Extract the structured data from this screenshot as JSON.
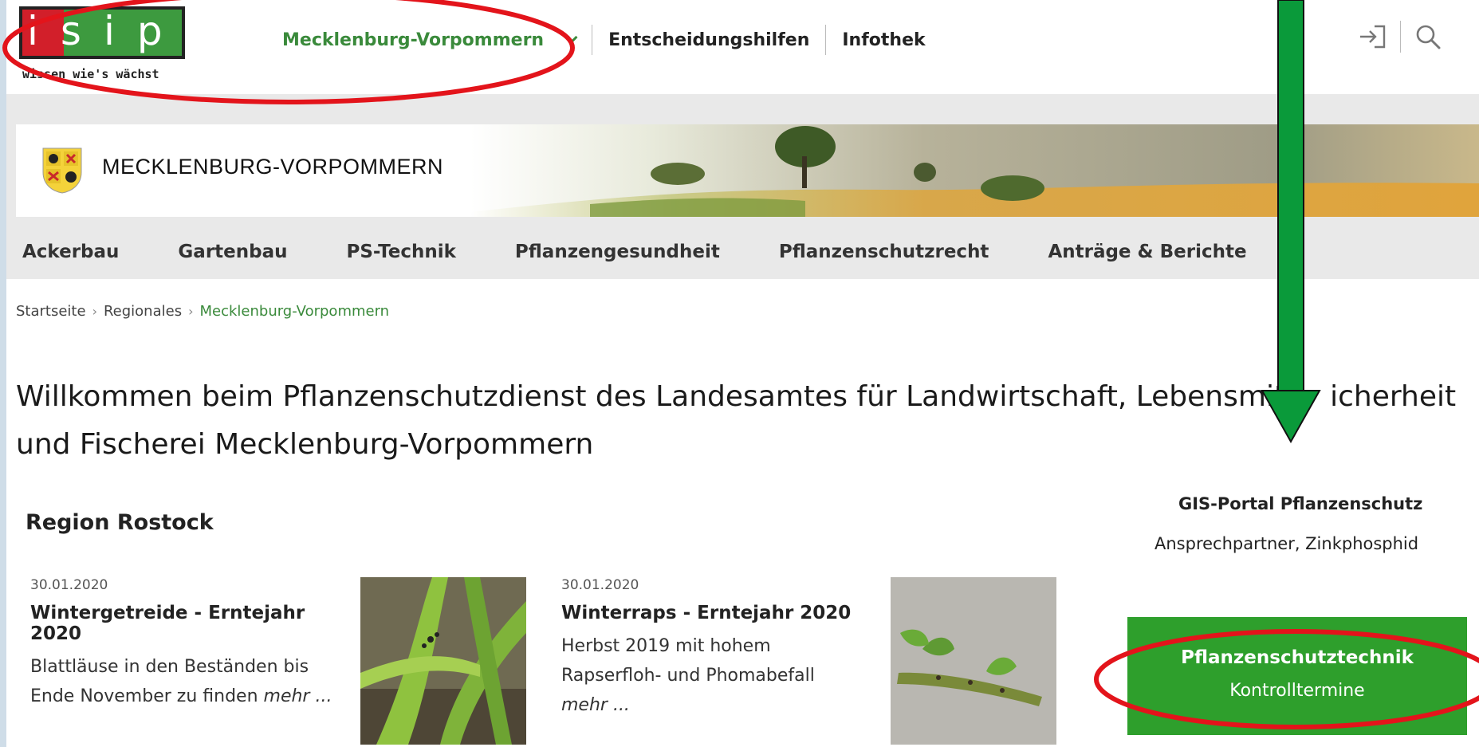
{
  "logo": {
    "text": "isip",
    "tagline": "wissen wie's wächst"
  },
  "topnav": {
    "region": "Mecklenburg-Vorpommern",
    "items": [
      "Entscheidungshilfen",
      "Infothek"
    ]
  },
  "tools": {
    "login_icon": "login-icon",
    "search_icon": "search-icon"
  },
  "banner": {
    "title": "MECKLENBURG-VORPOMMERN"
  },
  "mainnav": [
    "Ackerbau",
    "Gartenbau",
    "PS-Technik",
    "Pflanzengesundheit",
    "Pflanzenschutzrecht",
    "Anträge & Berichte"
  ],
  "breadcrumb": {
    "items": [
      "Startseite",
      "Regionales"
    ],
    "current": "Mecklenburg-Vorpommern",
    "separator": "›"
  },
  "heading": {
    "line1": "Willkommen beim Pflanzenschutzdienst des Landesamtes für Landwirtschaft, Lebensmit",
    "line1_end": "icherheit",
    "line2": "und Fischerei Mecklenburg-Vorpommern"
  },
  "region": {
    "title": "Region Rostock"
  },
  "news": [
    {
      "date": "30.01.2020",
      "title": "Wintergetreide - Erntejahr 2020",
      "line1": "Blattläuse in den Beständen bis",
      "line2": "Ende November zu finden",
      "more": "mehr ..."
    },
    {
      "date": "30.01.2020",
      "title": "Winterraps - Erntejahr 2020",
      "line1": "Herbst 2019 mit hohem",
      "line2": "Rapserfloh- und Phomabefall",
      "more": "mehr ..."
    }
  ],
  "sidebar": {
    "gis_link": "GIS-Portal Pflanzenschutz",
    "contact_link": "Ansprechpartner, Zinkphosphid",
    "box_title": "Pflanzenschutztechnik",
    "box_subtitle": "Kontrolltermine"
  },
  "colors": {
    "brand_green": "#3a8a3b",
    "box_green": "#2e9f2c",
    "annotation_red": "#e3141b",
    "arrow_green": "#0a9a3a"
  }
}
